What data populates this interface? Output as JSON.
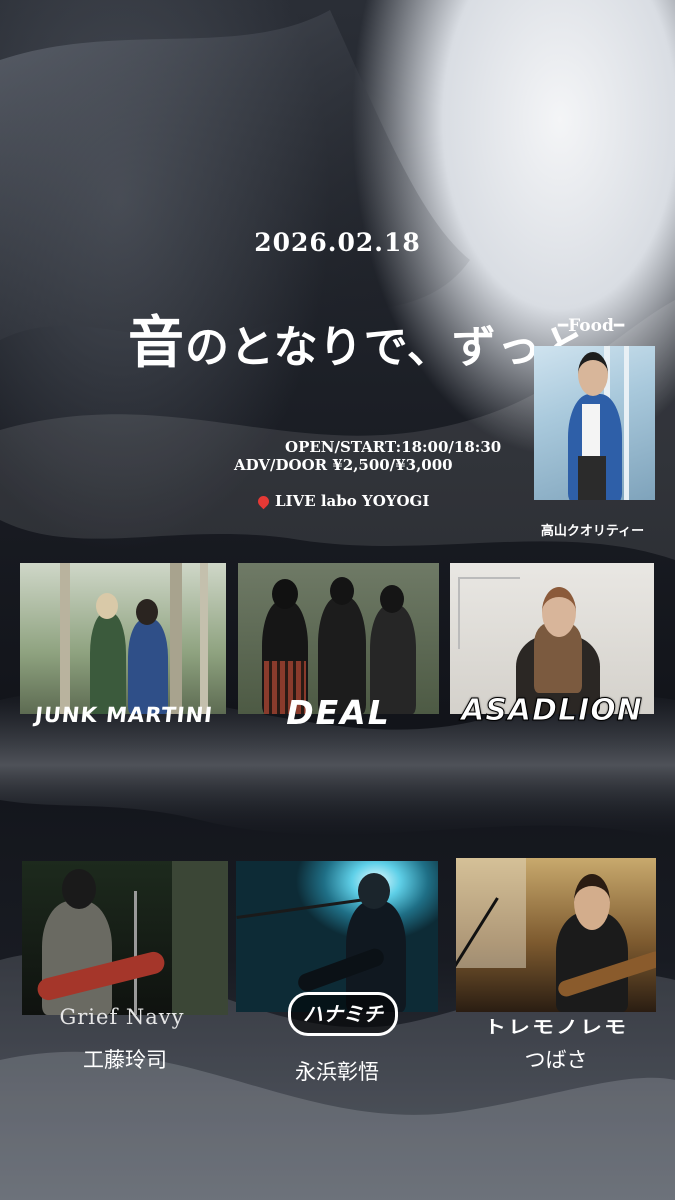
{
  "event": {
    "date": "2026.02.18",
    "title_first": "音",
    "title_rest": "のとなりで、ずっと",
    "open_start": "OPEN/START:18:00/18:30",
    "adv_door": "ADV/DOOR ¥2,500/¥3,000",
    "venue": "LIVE labo YOYOGI",
    "venue_icon": "map-pin-icon"
  },
  "food": {
    "heading": "━Food━",
    "name": "高山クオリティー"
  },
  "bands_row1": [
    {
      "logo": "JUNK MARTINI"
    },
    {
      "logo": "DEAL"
    },
    {
      "logo": "ASADLION"
    }
  ],
  "bands_row2": [
    {
      "logo": "Grief Navy",
      "member": "工藤玲司"
    },
    {
      "logo": "ハナミチ",
      "member": "永浜彰悟"
    },
    {
      "logo": "トレモノレモ",
      "member": "つばさ"
    }
  ]
}
